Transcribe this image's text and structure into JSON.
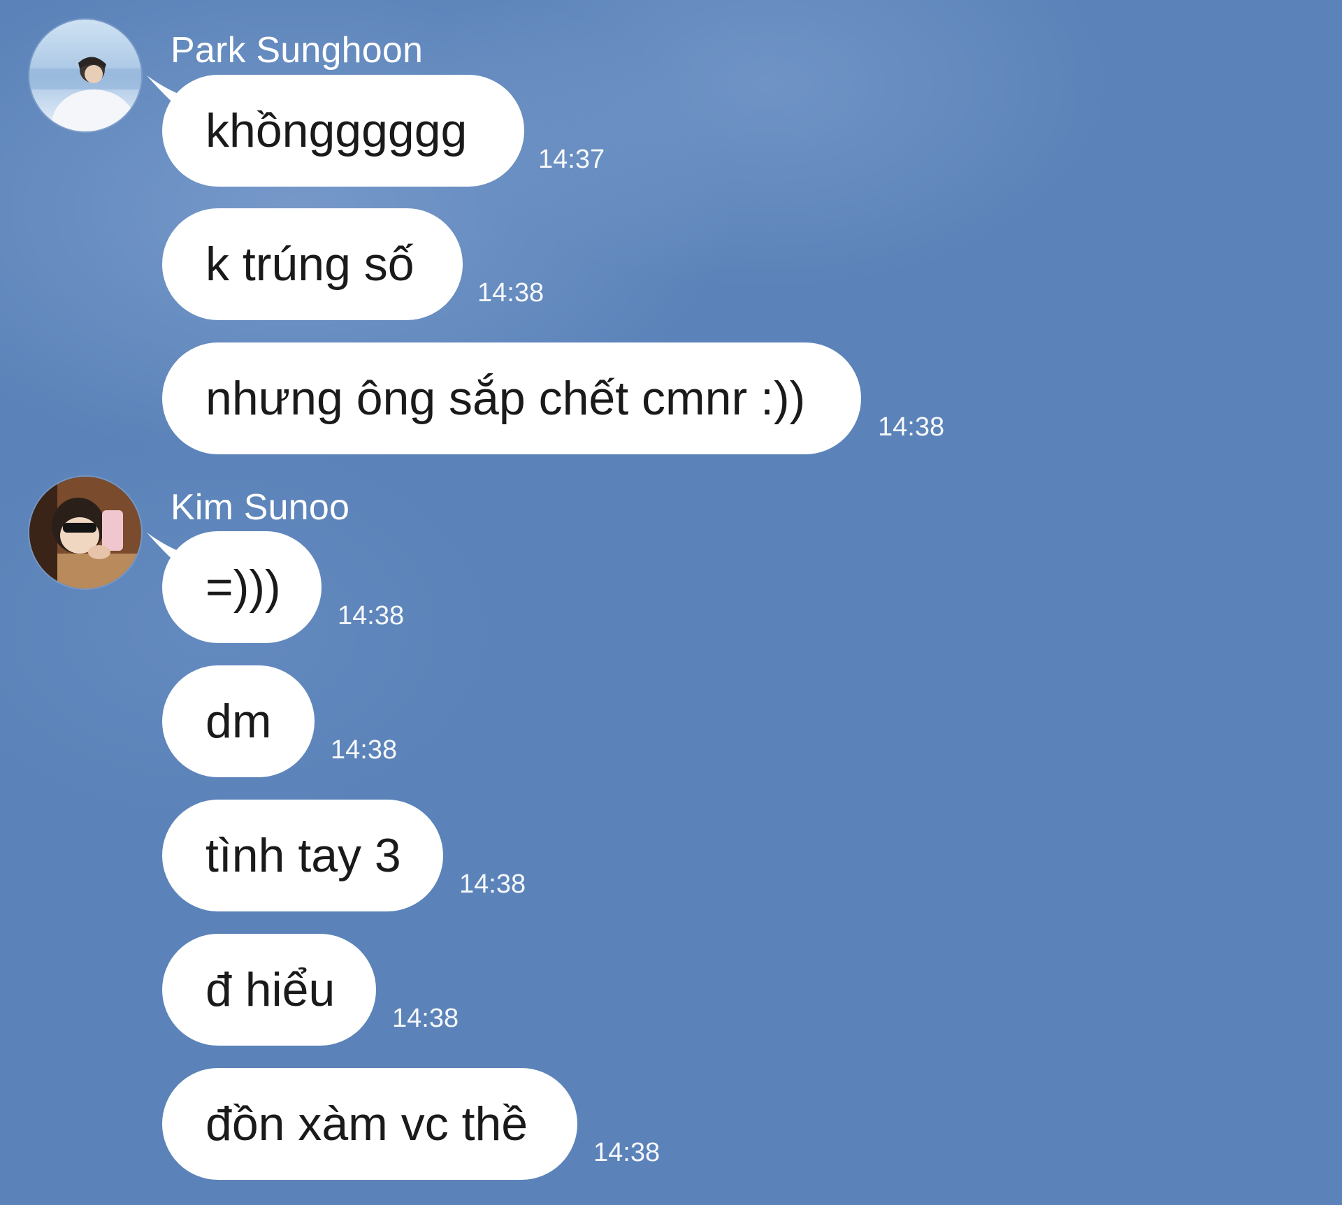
{
  "colors": {
    "background": "#5b83b9",
    "bubble": "#ffffff",
    "bubble_text": "#1a1a1a",
    "meta_text": "#ffffff"
  },
  "chat": {
    "groups": [
      {
        "sender": "Park Sunghoon",
        "avatar": "profile-photo-sunghoon",
        "messages": [
          {
            "text": "khồngggggg",
            "time": "14:37"
          },
          {
            "text": "k trúng số",
            "time": "14:38"
          },
          {
            "text": "nhưng ông sắp chết cmnr :))",
            "time": "14:38"
          }
        ]
      },
      {
        "sender": "Kim Sunoo",
        "avatar": "profile-photo-sunoo",
        "messages": [
          {
            "text": "=)))",
            "time": "14:38"
          },
          {
            "text": "dm",
            "time": "14:38"
          },
          {
            "text": "tình tay 3",
            "time": "14:38"
          },
          {
            "text": "đ hiểu",
            "time": "14:38"
          },
          {
            "text": "đồn xàm vc thề",
            "time": "14:38"
          }
        ]
      }
    ]
  }
}
